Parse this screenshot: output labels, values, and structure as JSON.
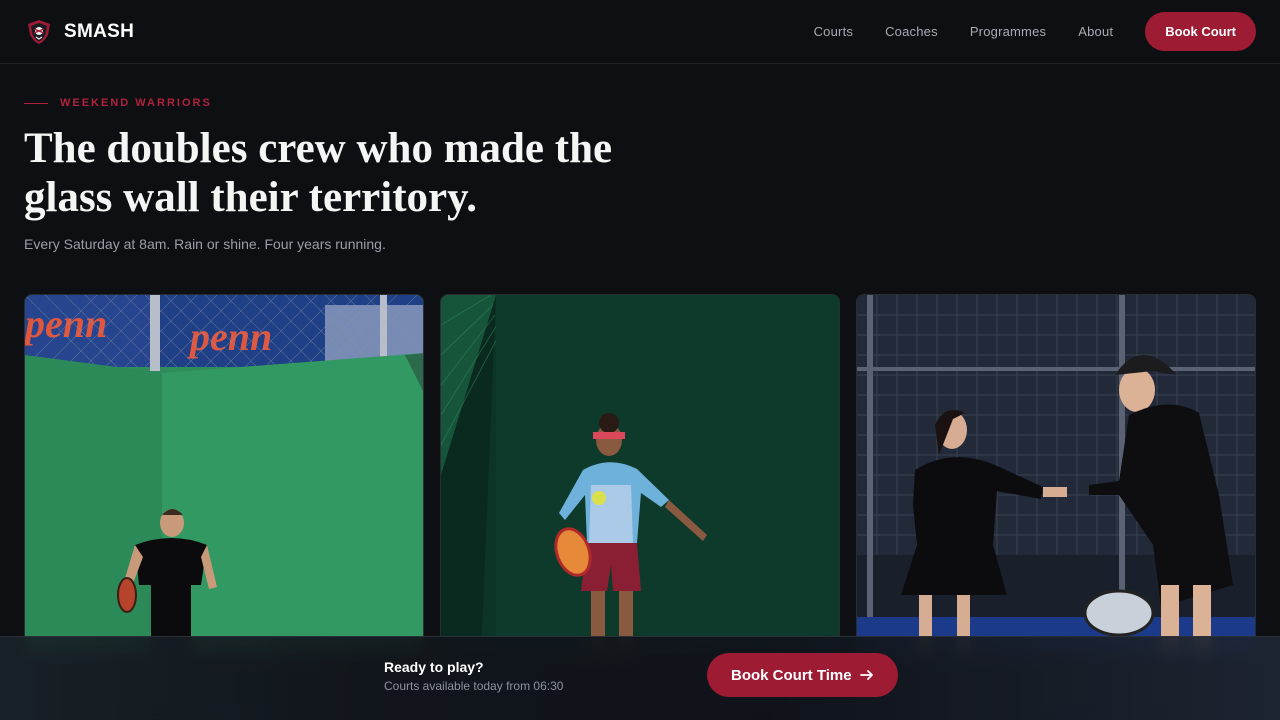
{
  "brand": {
    "name": "SMASH",
    "icon": "shield-logo-icon"
  },
  "nav": {
    "links": [
      "Courts",
      "Coaches",
      "Programmes",
      "About"
    ],
    "cta_label": "Book Court"
  },
  "hero": {
    "eyebrow": "WEEKEND WARRIORS",
    "headline_line1": "The doubles crew who made the",
    "headline_line2": "glass wall their territory.",
    "subhead": "Every Saturday at 8am. Rain or shine. Four years running."
  },
  "gallery": {
    "cards": [
      {
        "subject": "player-with-paddle-green-wall"
      },
      {
        "subject": "player-hitting-ball-dark-green"
      },
      {
        "subject": "players-high-five-night-court"
      }
    ]
  },
  "booking_bar": {
    "title": "Ready to play?",
    "subtitle": "Courts available today from 06:30",
    "cta_label": "Book Court Time",
    "cta_icon": "arrow-right-icon"
  },
  "colors": {
    "accent": "#9e1b34",
    "background": "#0e0f13"
  }
}
